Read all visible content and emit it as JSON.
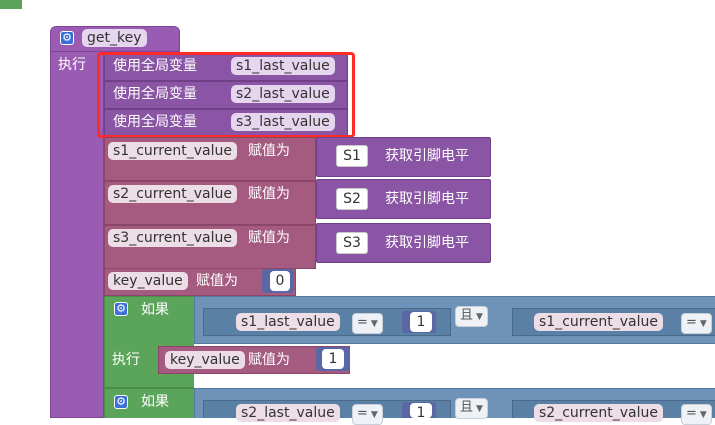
{
  "func_name": "get_key",
  "exec_label": "执行",
  "global_label": "使用全局变量",
  "globals": [
    "s1_last_value",
    "s2_last_value",
    "s3_last_value"
  ],
  "assign_label": "赋值为",
  "current_vars": [
    "s1_current_value",
    "s2_current_value",
    "s3_current_value"
  ],
  "pins": [
    "S1",
    "S2",
    "S3"
  ],
  "get_pin_label": "获取引脚电平",
  "key_var": "key_value",
  "key_init": "0",
  "if_label": "如果",
  "and_label": "且",
  "eq_op": "=",
  "num_one": "1",
  "if_exec_label": "执行",
  "if1_left": "s1_last_value",
  "if1_right": "s1_current_value",
  "if1_assign_value": "1",
  "if2_left": "s2_last_value",
  "if2_right": "s2_current_value",
  "colors": {
    "procedure": "#9a5cb3",
    "variables": "#a55b80",
    "logic": "#5b80a5",
    "control": "#5ba55b",
    "math": "#5b67a5",
    "highlight": "#ff2a2a"
  }
}
